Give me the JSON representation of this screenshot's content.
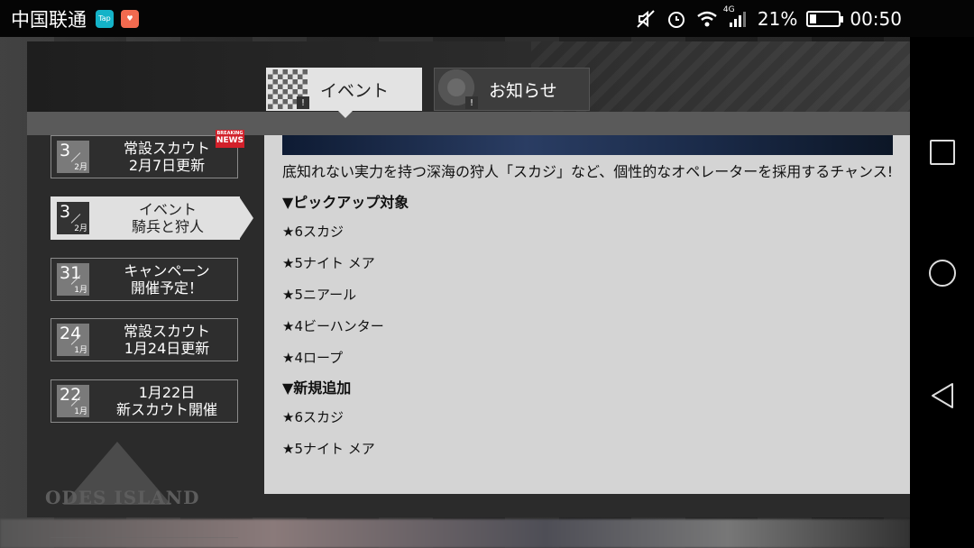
{
  "status_bar": {
    "carrier": "中国联通",
    "app_badge_1": "Tap",
    "network": "4G",
    "battery_percent": "21%",
    "battery_level": 0.21,
    "time": "00:50"
  },
  "tabs": {
    "event": "イベント",
    "notice": "お知らせ"
  },
  "news_list": {
    "breaking_badge_top": "BREAKING",
    "breaking_badge_bottom": "NEWS",
    "items": [
      {
        "day": "3",
        "month": "2月",
        "line1": "常設スカウト",
        "line2": "2月7日更新"
      },
      {
        "day": "3",
        "month": "2月",
        "line1": "イベント",
        "line2": "騎兵と狩人"
      },
      {
        "day": "31",
        "month": "1月",
        "line1": "キャンペーン",
        "line2": "開催予定！"
      },
      {
        "day": "24",
        "month": "1月",
        "line1": "常設スカウト",
        "line2": "1月24日更新"
      },
      {
        "day": "22",
        "month": "1月",
        "line1": "1月22日",
        "line2": "新スカウト開催"
      }
    ],
    "emblem_text": "ODES ISLAND"
  },
  "content": {
    "intro": "底知れない実力を持つ深海の狩人「スカジ」など、個性的なオペレーターを採用するチャンス!",
    "section_pickup": "▼ピックアップ対象",
    "pickup": [
      "★6スカジ",
      "★5ナイト メア",
      "★5ニアール",
      "★4ビーハンター",
      "★4ロープ"
    ],
    "section_new": "▼新規追加",
    "new_additions": [
      "★6スカジ",
      "★5ナイト メア"
    ]
  }
}
